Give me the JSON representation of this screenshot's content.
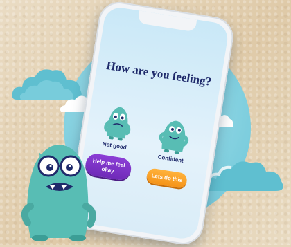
{
  "screen": {
    "heading": "How are you feeling?",
    "moods": [
      {
        "label": "Not good",
        "icon": "sad-monster-icon"
      },
      {
        "label": "Confident",
        "icon": "confident-monster-icon"
      }
    ],
    "buttons": {
      "help_label": "Help me feel okay",
      "go_label": "Lets do this"
    }
  },
  "colors": {
    "accent_purple": "#7a33c6",
    "accent_orange": "#f7a020",
    "heading_navy": "#1f2a6b",
    "monster_teal": "#58bdb4"
  }
}
